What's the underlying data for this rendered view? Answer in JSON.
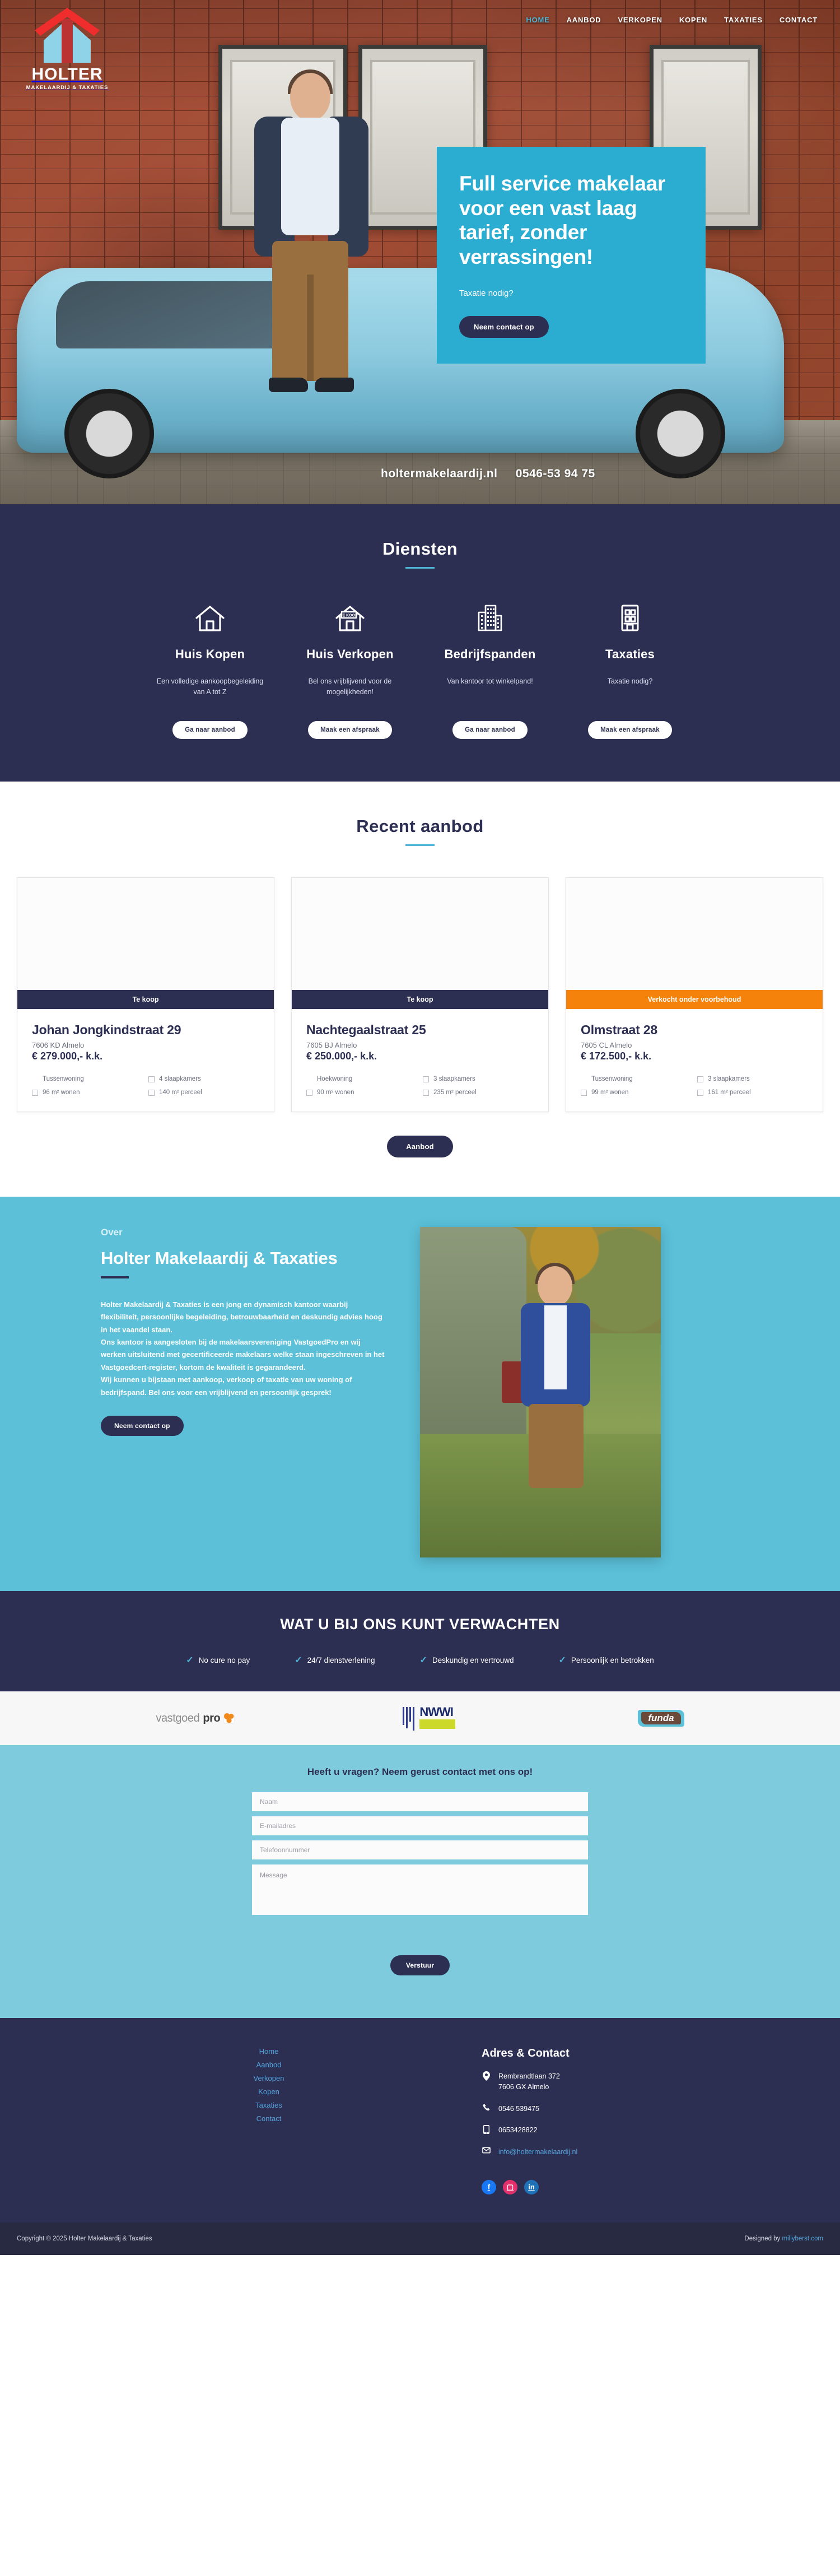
{
  "brand": {
    "name": "HOLTER",
    "tagline": "MAKELAARDIJ & TAXATIES",
    "accent_blue": "#4fb6d8",
    "navy": "#2c2e52",
    "orange": "#f5820b"
  },
  "nav": {
    "items": [
      {
        "label": "HOME",
        "active": true
      },
      {
        "label": "AANBOD",
        "active": false
      },
      {
        "label": "VERKOPEN",
        "active": false
      },
      {
        "label": "KOPEN",
        "active": false
      },
      {
        "label": "TAXATIES",
        "active": false
      },
      {
        "label": "CONTACT",
        "active": false
      }
    ]
  },
  "hero": {
    "heading": "Full service makelaar voor een vast laag tarief, zonder verrassingen!",
    "subheading": "Taxatie nodig?",
    "cta": "Neem contact op",
    "car_site": "holtermakelaardij.nl",
    "car_phone": "0546-53 94 75"
  },
  "diensten": {
    "title": "Diensten",
    "items": [
      {
        "icon": "house-icon",
        "name": "Huis Kopen",
        "desc": "Een volledige aankoopbegeleiding van A tot Z",
        "cta": "Ga naar aanbod"
      },
      {
        "icon": "house-for-sale-icon",
        "name": "Huis Verkopen",
        "desc": "Bel ons vrijblijvend voor de mogelijkheden!",
        "cta": "Maak een afspraak"
      },
      {
        "icon": "office-buildings-icon",
        "name": "Bedrijfspanden",
        "desc": "Van kantoor tot winkelpand!",
        "cta": "Ga naar aanbod"
      },
      {
        "icon": "apartment-icon",
        "name": "Taxaties",
        "desc": "Taxatie nodig?",
        "cta": "Maak een afspraak"
      }
    ]
  },
  "aanbod": {
    "title": "Recent aanbod",
    "cta": "Aanbod",
    "properties": [
      {
        "status": "Te koop",
        "status_type": "tekoop",
        "title": "Johan Jongkindstraat 29",
        "zip": "7606 KD Almelo",
        "price": "€ 279.000,- k.k.",
        "type": "Tussenwoning",
        "bedrooms": "4 slaapkamers",
        "living": "96 m² wonen",
        "plot": "140 m² perceel"
      },
      {
        "status": "Te koop",
        "status_type": "tekoop",
        "title": "Nachtegaalstraat 25",
        "zip": "7605 BJ Almelo",
        "price": "€ 250.000,- k.k.",
        "type": "Hoekwoning",
        "bedrooms": "3 slaapkamers",
        "living": "90 m² wonen",
        "plot": "235 m² perceel"
      },
      {
        "status": "Verkocht onder voorbehoud",
        "status_type": "verkocht",
        "title": "Olmstraat 28",
        "zip": "7605 CL Almelo",
        "price": "€ 172.500,- k.k.",
        "type": "Tussenwoning",
        "bedrooms": "3 slaapkamers",
        "living": "99 m² wonen",
        "plot": "161 m² perceel"
      }
    ]
  },
  "over": {
    "kicker": "Over",
    "title": "Holter Makelaardij & Taxaties",
    "paragraph1": "Holter Makelaardij & Taxaties is een jong en dynamisch kantoor waarbij flexibiliteit, persoonlijke begeleiding, betrouwbaarheid en deskundig advies hoog in het vaandel staan.",
    "paragraph2": "Ons kantoor is aangesloten bij de makelaarsvereniging VastgoedPro en wij werken uitsluitend met gecertificeerde makelaars welke staan ingeschreven in het Vastgoedcert-register, kortom de kwaliteit is gegarandeerd.",
    "paragraph3": "Wij kunnen u bijstaan met aankoop, verkoop of taxatie van uw woning of bedrijfspand. Bel ons voor een vrijblijvend en persoonlijk gesprek!",
    "cta": "Neem contact op"
  },
  "verwachten": {
    "title": "WAT U BIJ ONS KUNT VERWACHTEN",
    "items": [
      "No cure no pay",
      "24/7 dienstverlening",
      "Deskundig en vertrouwd",
      "Persoonlijk en betrokken"
    ]
  },
  "partners": [
    {
      "name": "vastgoedpro-logo",
      "text_light": "vastgoed",
      "text_bold": "pro"
    },
    {
      "name": "nwwi-logo",
      "text": "NWWI"
    },
    {
      "name": "funda-logo",
      "text": "funda"
    }
  ],
  "contact": {
    "title": "Heeft u vragen? Neem gerust contact met ons op!",
    "fields": {
      "naam": "Naam",
      "email": "E-mailadres",
      "telefoon": "Telefoonnummer",
      "message": "Message"
    },
    "submit": "Verstuur"
  },
  "footer": {
    "nav": [
      "Home",
      "Aanbod",
      "Verkopen",
      "Kopen",
      "Taxaties",
      "Contact"
    ],
    "contact_title": "Adres & Contact",
    "address_line1": "Rembrandtlaan 372",
    "address_line2": "7606 GX Almelo",
    "phone": "0546 539475",
    "mobile": "0653428822",
    "email": "info@holtermakelaardij.nl",
    "socials": [
      "facebook-icon",
      "instagram-icon",
      "linkedin-icon"
    ]
  },
  "copyright": {
    "left": "Copyright © 2025 Holter Makelaardij & Taxaties",
    "right_prefix": "Designed by ",
    "right_link": "millyberst.com"
  }
}
